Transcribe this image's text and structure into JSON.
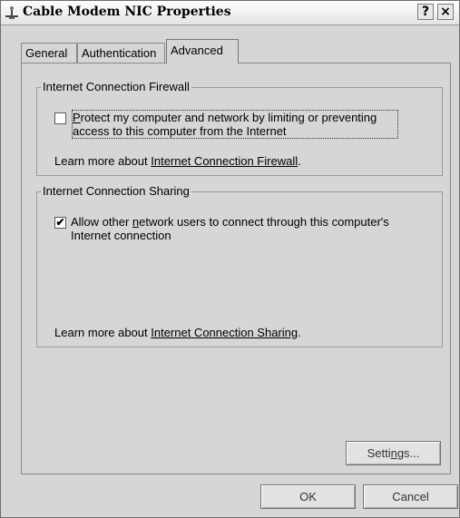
{
  "window": {
    "title": "Cable Modem NIC Properties",
    "help_label": "?",
    "close_label": "×",
    "icon": "network-connection-icon"
  },
  "tabs": [
    {
      "label": "General",
      "active": false
    },
    {
      "label": "Authentication",
      "active": false
    },
    {
      "label": "Advanced",
      "active": true
    }
  ],
  "firewall": {
    "group_title": "Internet Connection Firewall",
    "checkbox_checked": false,
    "checkbox_label_mnemonic": "P",
    "checkbox_label_line1_rest": "rotect my computer and network by limiting or preventing",
    "checkbox_label_line2": "access to this computer from the Internet",
    "learn_prefix": "Learn more about ",
    "learn_link": "Internet Connection Firewall",
    "learn_suffix": "."
  },
  "sharing": {
    "group_title": "Internet Connection Sharing",
    "checkbox_checked": true,
    "checkbox_label_pre": "Allow other ",
    "checkbox_label_mnemonic": "n",
    "checkbox_label_post": "etwork users to connect through this computer's",
    "checkbox_label_line2": "Internet connection",
    "learn_prefix": "Learn more about ",
    "learn_link": "Internet Connection Sharing",
    "learn_suffix": "."
  },
  "buttons": {
    "settings_pre": "Setti",
    "settings_mnemonic": "n",
    "settings_post": "gs...",
    "ok": "OK",
    "cancel": "Cancel"
  }
}
